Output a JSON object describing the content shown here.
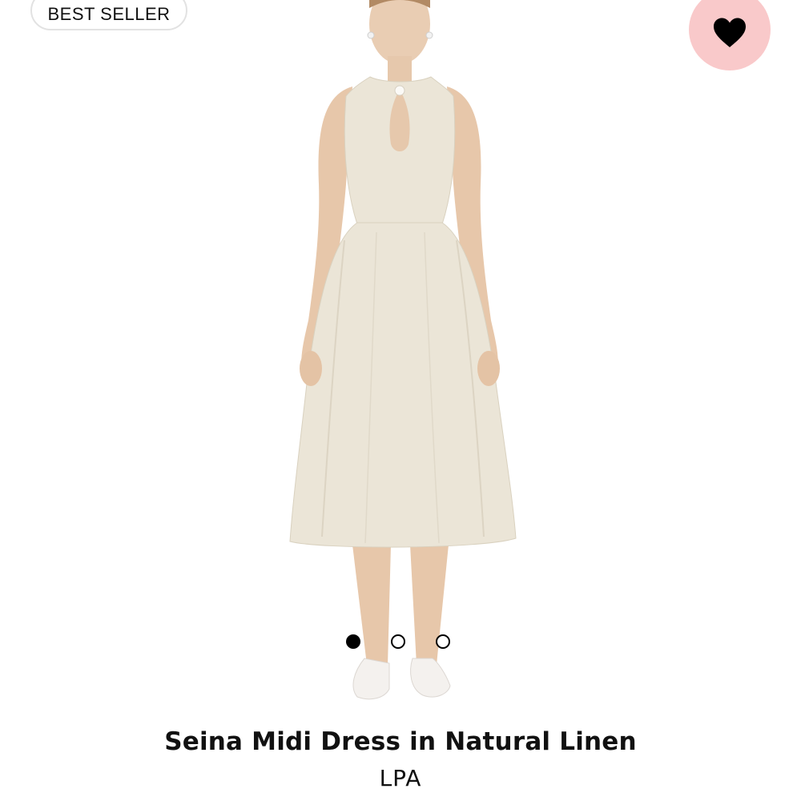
{
  "badge": {
    "label": "BEST SELLER"
  },
  "favorite": {
    "icon": "heart-icon",
    "button_bg": "#f9c9ca",
    "icon_color": "#000000"
  },
  "product": {
    "name": "Seina Midi Dress in Natural Linen",
    "brand": "LPA",
    "image": "sleeveless linen midi dress with keyhole cutout on model",
    "dress_color": "#ebe5d7"
  },
  "carousel": {
    "total": 3,
    "active_index": 0
  }
}
